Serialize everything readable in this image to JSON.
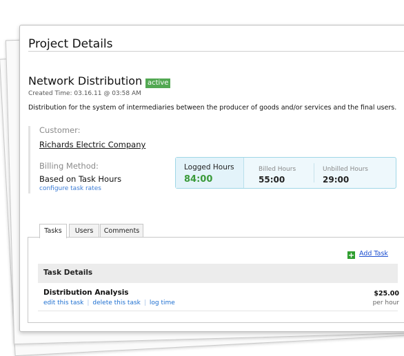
{
  "page": {
    "title": "Project Details"
  },
  "project": {
    "name": "Network Distribution",
    "status": "active",
    "created": "Created Time: 03.16.11 @ 03:58 AM",
    "description": "Distribution for the system of intermediaries between the producer of goods and/or services and the final users."
  },
  "customer": {
    "label": "Customer:",
    "name": "Richards Electric Company"
  },
  "billing": {
    "label": "Billing Method:",
    "value": "Based on Task Hours",
    "configure_link": "configure task rates"
  },
  "hours": {
    "logged_label": "Logged Hours",
    "logged_value": "84:00",
    "billed_label": "Billed Hours",
    "billed_value": "55:00",
    "unbilled_label": "Unbilled Hours",
    "unbilled_value": "29:00"
  },
  "tabs": [
    {
      "label": "Tasks",
      "active": true
    },
    {
      "label": "Users",
      "active": false
    },
    {
      "label": "Comments",
      "active": false
    }
  ],
  "tasks": {
    "add_label": "Add Task",
    "add_icon": "plus-icon",
    "header": "Task Details",
    "items": [
      {
        "name": "Distribution Analysis",
        "actions": [
          "edit this task",
          "delete this task",
          "log time"
        ],
        "rate": "$25.00",
        "rate_unit": "per hour"
      }
    ]
  },
  "colors": {
    "badge": "#52a852",
    "logged_value": "#3a9a3a",
    "link": "#3a7bd5",
    "hours_box_border": "#9fd6e6"
  }
}
